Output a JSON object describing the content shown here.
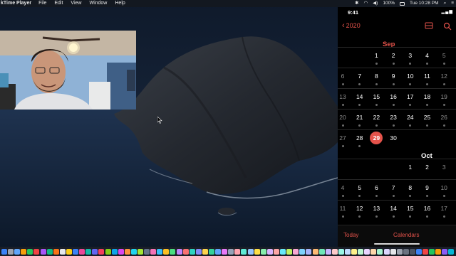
{
  "menubar": {
    "app_name": "kTime Player",
    "items": [
      "File",
      "Edit",
      "View",
      "Window",
      "Help"
    ],
    "battery": "100%",
    "datetime": "Tue 10:28 PM",
    "icons": [
      "bluetooth-icon",
      "wifi-icon",
      "volume-icon",
      "airplay-icon",
      "spotlight-icon"
    ]
  },
  "phone": {
    "status_time": "9:41",
    "nav_back_label": "2020",
    "weekdays": [
      "",
      "",
      "",
      "",
      "",
      "",
      ""
    ],
    "sep_label": "Sep",
    "oct_label": "Oct",
    "sep_weeks": [
      [
        {
          "d": "",
          "dot": false
        },
        {
          "d": "",
          "dot": false
        },
        {
          "d": "1",
          "dot": true
        },
        {
          "d": "2",
          "dot": true
        },
        {
          "d": "3",
          "dot": true
        },
        {
          "d": "4",
          "dot": true
        },
        {
          "d": "5",
          "dot": true
        }
      ],
      [
        {
          "d": "6",
          "dot": true
        },
        {
          "d": "7",
          "dot": true
        },
        {
          "d": "8",
          "dot": true
        },
        {
          "d": "9",
          "dot": true
        },
        {
          "d": "10",
          "dot": true
        },
        {
          "d": "11",
          "dot": true
        },
        {
          "d": "12",
          "dot": true
        }
      ],
      [
        {
          "d": "13",
          "dot": true
        },
        {
          "d": "14",
          "dot": true
        },
        {
          "d": "15",
          "dot": true
        },
        {
          "d": "16",
          "dot": true
        },
        {
          "d": "17",
          "dot": true
        },
        {
          "d": "18",
          "dot": true
        },
        {
          "d": "19",
          "dot": true
        }
      ],
      [
        {
          "d": "20",
          "dot": true
        },
        {
          "d": "21",
          "dot": true
        },
        {
          "d": "22",
          "dot": true
        },
        {
          "d": "23",
          "dot": true
        },
        {
          "d": "24",
          "dot": true
        },
        {
          "d": "25",
          "dot": true
        },
        {
          "d": "26",
          "dot": true
        }
      ],
      [
        {
          "d": "27",
          "dot": true
        },
        {
          "d": "28",
          "dot": true
        },
        {
          "d": "29",
          "dot": false,
          "today": true
        },
        {
          "d": "30",
          "dot": false
        },
        {
          "d": "",
          "dot": false
        },
        {
          "d": "",
          "dot": false
        },
        {
          "d": "",
          "dot": false
        }
      ]
    ],
    "oct_weeks": [
      [
        {
          "d": "",
          "dot": false
        },
        {
          "d": "",
          "dot": false
        },
        {
          "d": "",
          "dot": false
        },
        {
          "d": "",
          "dot": false
        },
        {
          "d": "1",
          "dot": false
        },
        {
          "d": "2",
          "dot": false
        },
        {
          "d": "3",
          "dot": false
        }
      ],
      [
        {
          "d": "4",
          "dot": true
        },
        {
          "d": "5",
          "dot": true
        },
        {
          "d": "6",
          "dot": true
        },
        {
          "d": "7",
          "dot": true
        },
        {
          "d": "8",
          "dot": true
        },
        {
          "d": "9",
          "dot": true
        },
        {
          "d": "10",
          "dot": true
        }
      ],
      [
        {
          "d": "11",
          "dot": true
        },
        {
          "d": "12",
          "dot": true
        },
        {
          "d": "13",
          "dot": true
        },
        {
          "d": "14",
          "dot": true
        },
        {
          "d": "15",
          "dot": true
        },
        {
          "d": "16",
          "dot": true
        },
        {
          "d": "17",
          "dot": true
        }
      ]
    ],
    "bottom": {
      "today": "Today",
      "calendars": "Calendars",
      "inbox": ""
    },
    "accent": "#e5534b"
  },
  "dock": {
    "colors": [
      "#3b82f6",
      "#9ca3af",
      "#60a5fa",
      "#f59e0b",
      "#22c55e",
      "#ef4444",
      "#a855f7",
      "#10b981",
      "#f97316",
      "#e5e7eb",
      "#facc15",
      "#3b82f6",
      "#ec4899",
      "#14b8a6",
      "#6366f1",
      "#f43f5e",
      "#84cc16",
      "#0ea5e9",
      "#d946ef",
      "#fb923c",
      "#22d3ee",
      "#a3e635",
      "#64748b",
      "#f472b6",
      "#38bdf8",
      "#fbbf24",
      "#4ade80",
      "#c084fc",
      "#f87171",
      "#2dd4bf",
      "#818cf8",
      "#fcd34d",
      "#34d399",
      "#60a5fa",
      "#e879f9",
      "#94a3b8",
      "#fda4af",
      "#5eead4",
      "#93c5fd",
      "#fde047",
      "#86efac",
      "#d8b4fe",
      "#fca5a5",
      "#67e8f9",
      "#bef264",
      "#f9a8d4",
      "#7dd3fc",
      "#a5b4fc",
      "#fdba74",
      "#6ee7b7",
      "#c4b5fd",
      "#fecaca",
      "#99f6e4",
      "#bfdbfe",
      "#fef08a",
      "#bbf7d0",
      "#e9d5ff",
      "#fed7aa",
      "#a7f3d0",
      "#ddd6fe",
      "#e5e7eb",
      "#9ca3af",
      "#6b7280",
      "#4b5563",
      "#3b82f6",
      "#ef4444",
      "#22c55e",
      "#f59e0b",
      "#8b5cf6",
      "#06b6d4"
    ]
  }
}
